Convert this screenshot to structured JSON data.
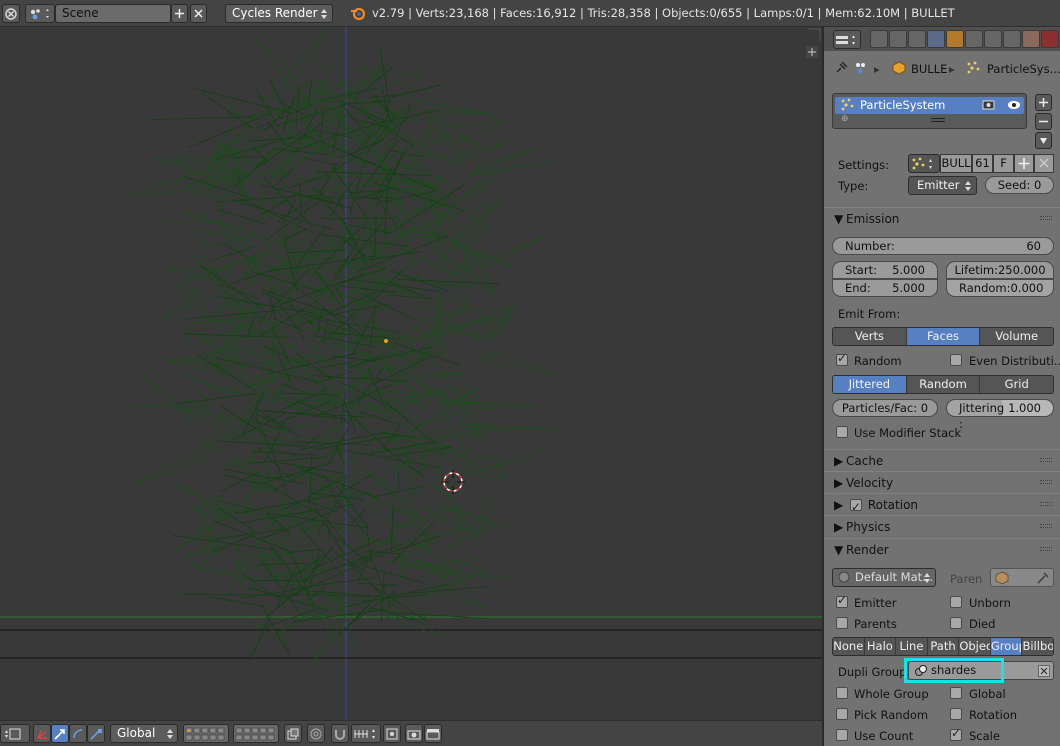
{
  "header": {
    "scene_label": "Scene",
    "engine_label": "Cycles Render",
    "stats": "v2.79 | Verts:23,168 | Faces:16,912 | Tris:28,358 | Objects:0/655 | Lamps:0/1 | Mem:62.10M | BULLET"
  },
  "viewport_toolbar": {
    "orientation_label": "Global"
  },
  "properties": {
    "breadcrumb": {
      "object": "BULLE",
      "particles": "ParticleSys..."
    },
    "particle_list": {
      "item": "ParticleSystem"
    },
    "settings_label": "Settings:",
    "settings_name": "BULL",
    "settings_users": "61",
    "settings_fake": "F",
    "type_label": "Type:",
    "type_value": "Emitter",
    "seed": "Seed: 0",
    "emission": {
      "title": "Emission",
      "number_label": "Number:",
      "number_value": "60",
      "start_label": "Start:",
      "start_value": "5.000",
      "end_label": "End:",
      "end_value": "5.000",
      "lifetime": "Lifetim:250.000",
      "random_label": "Random:",
      "random_value": "0.000",
      "emit_from_label": "Emit From:",
      "emit_from_options": [
        "Verts",
        "Faces",
        "Volume"
      ],
      "random_check": "Random",
      "even_distribution": "Even Distributi...",
      "distribution_options": [
        "Jittered",
        "Random",
        "Grid"
      ],
      "particles_per_face": "Particles/Fac: 0",
      "jittering_label": "Jittering :",
      "jittering_value": "1.000",
      "use_modifier_stack": "Use Modifier Stack"
    },
    "panels": {
      "cache": "Cache",
      "velocity": "Velocity",
      "rotation": "Rotation",
      "physics": "Physics",
      "render": "Render"
    },
    "render": {
      "material": "Default Mat...",
      "parent": "Paren",
      "emitter": "Emitter",
      "unborn": "Unborn",
      "parents": "Parents",
      "died": "Died",
      "render_as_options": [
        "None",
        "Halo",
        "Line",
        "Path",
        "Objec",
        "Group",
        "Billbo"
      ],
      "dupli_group_label": "Dupli Group:",
      "dupli_group_value": "shardes",
      "whole_group": "Whole Group",
      "global": "Global",
      "pick_random": "Pick Random",
      "rotation": "Rotation",
      "use_count": "Use Count",
      "scale": "Scale"
    }
  },
  "colors": {
    "wire": "#1d4a1d",
    "selected_blue": "#5680c2",
    "highlight_box": "#16e2e8"
  }
}
